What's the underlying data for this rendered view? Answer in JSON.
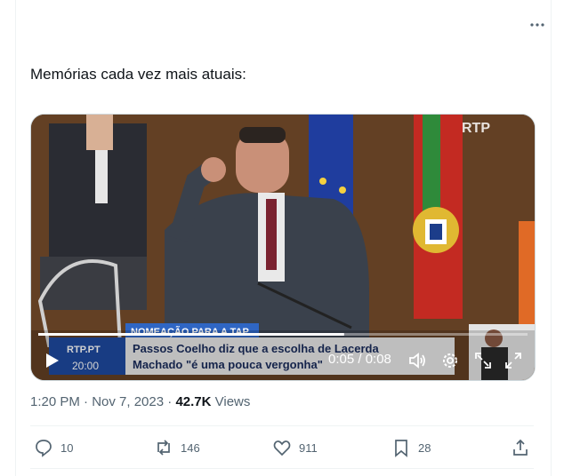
{
  "tweet": {
    "text": "Memórias cada vez mais atuais:",
    "timestamp": "1:20 PM · Nov 7, 2023",
    "views_count": "42.7K",
    "views_label": "Views"
  },
  "video": {
    "channel_logo": "RTP",
    "time_display": "0:05 / 0:08",
    "progress": 0.625,
    "lower_third": {
      "tag": "NOMEAÇÃO PARA A TAP",
      "headline_line1": "Passos Coelho diz que a escolha de Lacerda",
      "headline_line2": "Machado \"é uma pouca vergonha\"",
      "site": "RTP.PT",
      "clock": "20:00"
    }
  },
  "actions": {
    "replies": "10",
    "reposts": "146",
    "likes": "911",
    "bookmarks": "28"
  },
  "icons": [
    "more-icon",
    "play-icon",
    "volume-icon",
    "settings-icon",
    "minimize-icon",
    "fullscreen-icon",
    "reply-icon",
    "repost-icon",
    "like-icon",
    "bookmark-icon",
    "share-icon"
  ]
}
